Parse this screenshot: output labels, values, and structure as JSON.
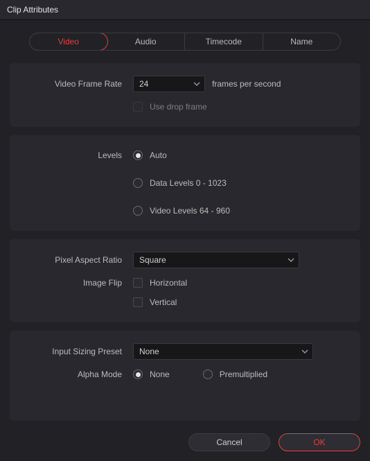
{
  "title": "Clip Attributes",
  "tabs": [
    "Video",
    "Audio",
    "Timecode",
    "Name"
  ],
  "active_tab": 0,
  "frame_rate": {
    "label": "Video Frame Rate",
    "value": "24",
    "suffix": "frames per second",
    "drop_frame_label": "Use drop frame",
    "drop_frame_checked": false,
    "drop_frame_enabled": false
  },
  "levels": {
    "label": "Levels",
    "options": [
      "Auto",
      "Data Levels 0 - 1023",
      "Video Levels 64 - 960"
    ],
    "selected": 0
  },
  "aspect": {
    "label": "Pixel Aspect Ratio",
    "value": "Square"
  },
  "flip": {
    "label": "Image Flip",
    "horizontal_label": "Horizontal",
    "vertical_label": "Vertical",
    "horizontal": false,
    "vertical": false
  },
  "sizing": {
    "label": "Input Sizing Preset",
    "value": "None"
  },
  "alpha": {
    "label": "Alpha Mode",
    "options": [
      "None",
      "Premultiplied"
    ],
    "selected": 0
  },
  "buttons": {
    "cancel": "Cancel",
    "ok": "OK"
  }
}
